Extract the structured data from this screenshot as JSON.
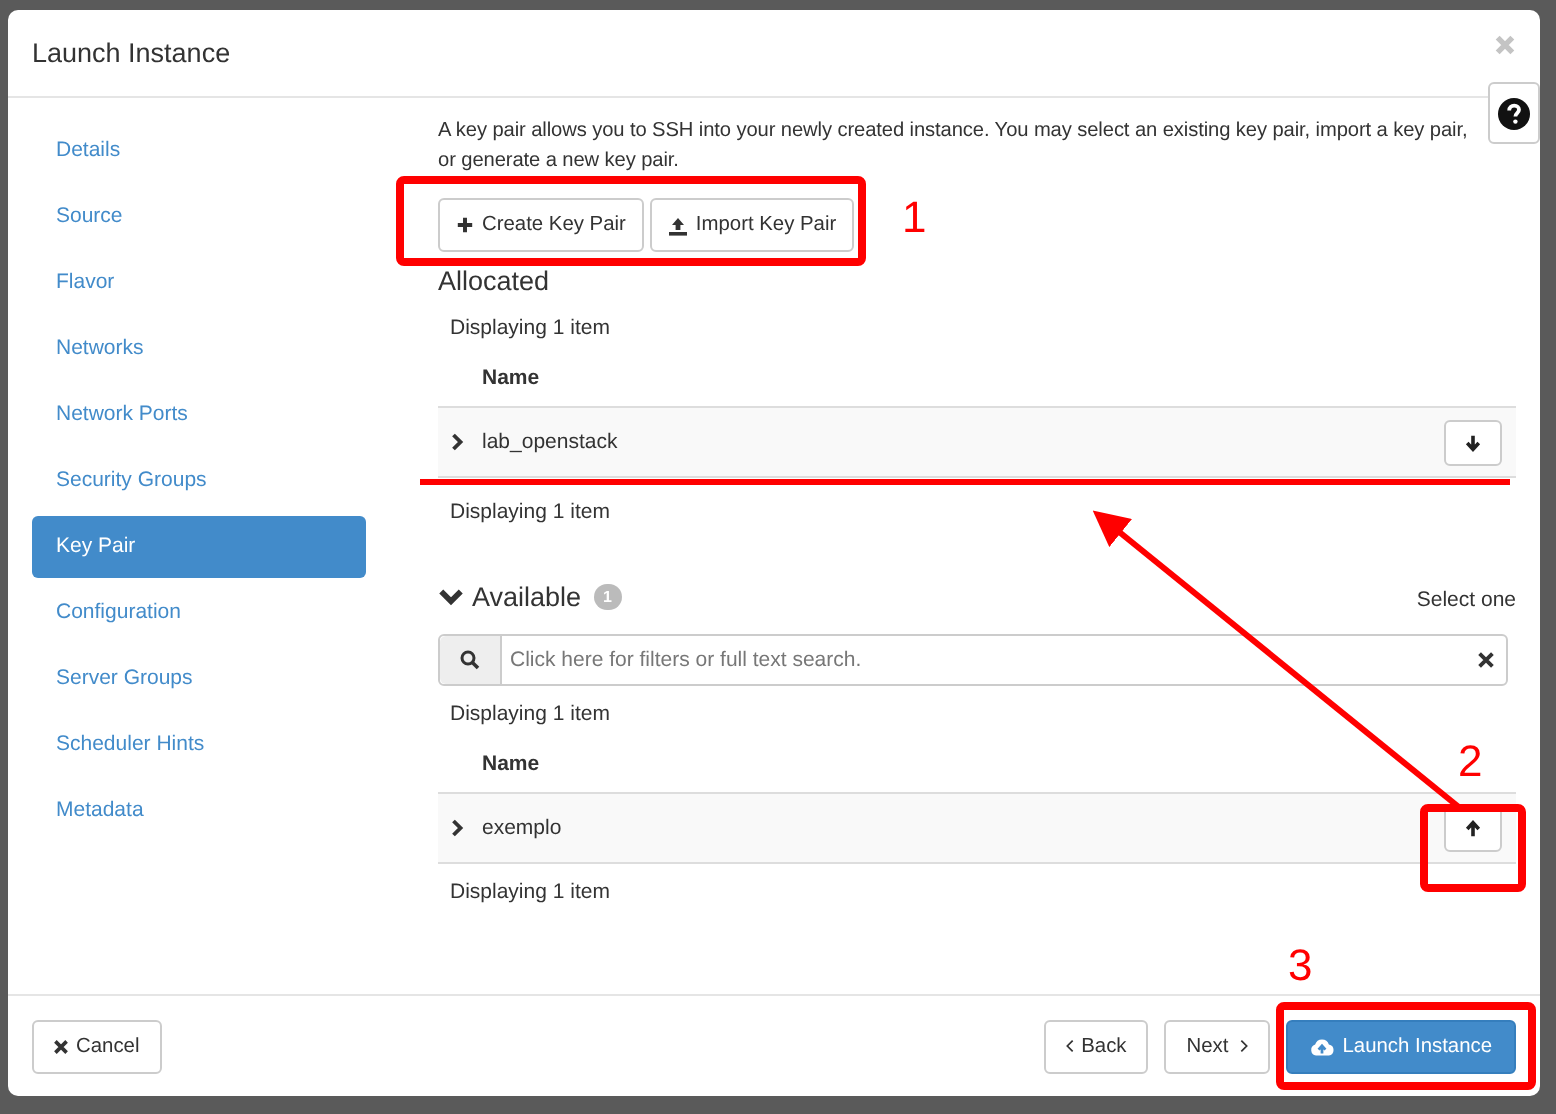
{
  "dialog": {
    "title": "Launch Instance"
  },
  "sidebar": {
    "items": [
      {
        "label": "Details",
        "selected": false
      },
      {
        "label": "Source",
        "selected": false
      },
      {
        "label": "Flavor",
        "selected": false
      },
      {
        "label": "Networks",
        "selected": false
      },
      {
        "label": "Network Ports",
        "selected": false
      },
      {
        "label": "Security Groups",
        "selected": false
      },
      {
        "label": "Key Pair",
        "selected": true
      },
      {
        "label": "Configuration",
        "selected": false
      },
      {
        "label": "Server Groups",
        "selected": false
      },
      {
        "label": "Scheduler Hints",
        "selected": false
      },
      {
        "label": "Metadata",
        "selected": false
      }
    ]
  },
  "description": "A key pair allows you to SSH into your newly created instance. You may select an existing key pair, import a key pair, or generate a new key pair.",
  "actions": [
    {
      "kind": "create",
      "label": "Create Key Pair"
    },
    {
      "kind": "import",
      "label": "Import Key Pair"
    }
  ],
  "allocated": {
    "heading": "Allocated",
    "count_top": "Displaying 1 item",
    "column": "Name",
    "rows": [
      {
        "name": "lab_openstack",
        "expanded": false
      }
    ],
    "count_bottom": "Displaying 1 item"
  },
  "available": {
    "heading": "Available",
    "badge": "1",
    "expanded": true,
    "hint": "Select one",
    "search": {
      "placeholder": "Click here for filters or full text search."
    },
    "count_top": "Displaying 1 item",
    "column": "Name",
    "rows": [
      {
        "name": "exemplo",
        "expanded": false
      }
    ],
    "count_bottom": "Displaying 1 item"
  },
  "footer": {
    "cancel": "Cancel",
    "back": "Back",
    "next": "Next",
    "launch": "Launch Instance"
  },
  "annotations": [
    {
      "label": "1"
    },
    {
      "label": "2"
    },
    {
      "label": "3"
    }
  ]
}
